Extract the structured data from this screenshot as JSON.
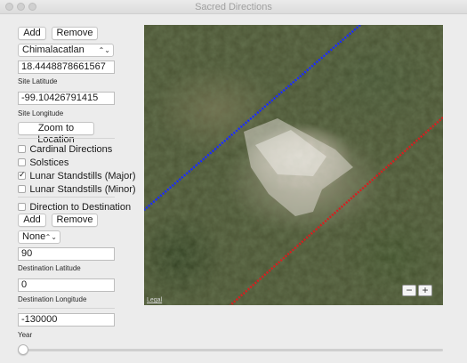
{
  "window": {
    "title": "Sacred Directions"
  },
  "site": {
    "add_label": "Add",
    "remove_label": "Remove",
    "selected_site": "Chimalacatlan",
    "latitude_value": "18.4448878661567",
    "latitude_caption": "Site Latitude",
    "longitude_value": "-99.10426791415",
    "longitude_caption": "Site Longitude",
    "zoom_button_label": "Zoom to Location"
  },
  "options": {
    "cardinal": {
      "label": "Cardinal Directions",
      "checked": false
    },
    "solstices": {
      "label": "Solstices",
      "checked": false
    },
    "lunar_major": {
      "label": "Lunar Standstills (Major)",
      "checked": true
    },
    "lunar_minor": {
      "label": "Lunar Standstills (Minor)",
      "checked": false
    }
  },
  "destination": {
    "toggle": {
      "label": "Direction to Destination",
      "checked": false
    },
    "add_label": "Add",
    "remove_label": "Remove",
    "selected": "None",
    "latitude_value": "90",
    "latitude_caption": "Destination Latitude",
    "longitude_value": "0",
    "longitude_caption": "Destination Longitude"
  },
  "year": {
    "value": "-130000",
    "caption": "Year",
    "slider_fraction": 0.0
  },
  "map": {
    "legal_label": "Legal",
    "zoom_out_symbol": "−",
    "zoom_in_symbol": "+",
    "line_colors": {
      "blue": "#1a2cff",
      "red": "#d42020"
    }
  }
}
